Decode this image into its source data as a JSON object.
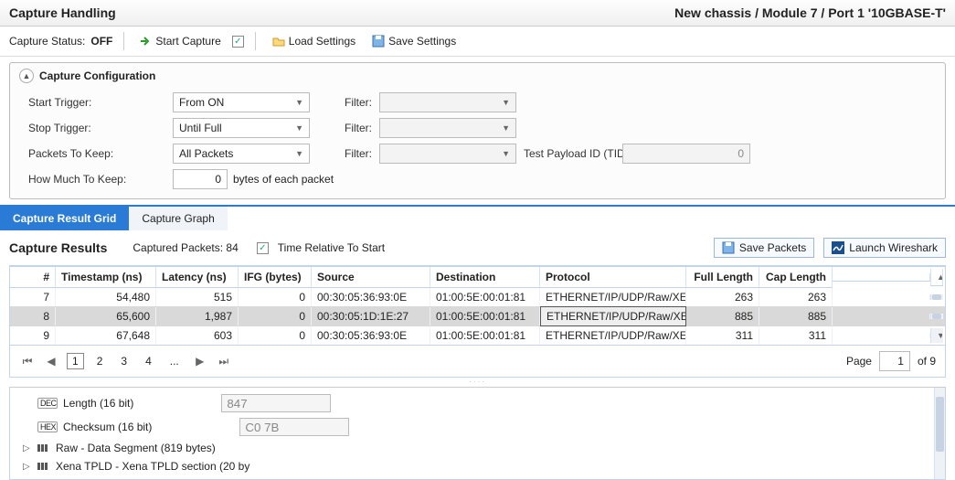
{
  "title": "Capture Handling",
  "breadcrumb": "New chassis / Module 7 / Port 1 '10GBASE-T'",
  "status": {
    "label": "Capture Status:",
    "value": "OFF"
  },
  "toolbar": {
    "start": "Start Capture",
    "load": "Load Settings",
    "save": "Save Settings"
  },
  "config": {
    "title": "Capture Configuration",
    "startTriggerLabel": "Start Trigger:",
    "startTriggerValue": "From ON",
    "stopTriggerLabel": "Stop Trigger:",
    "stopTriggerValue": "Until Full",
    "packetsLabel": "Packets To Keep:",
    "packetsValue": "All Packets",
    "howMuchLabel": "How Much To Keep:",
    "howMuchValue": "0",
    "howMuchSuffix": "bytes of each packet",
    "filterLabel": "Filter:",
    "tidLabel": "Test Payload ID (TID):",
    "tidValue": "0"
  },
  "tabs": {
    "grid": "Capture Result Grid",
    "graph": "Capture Graph"
  },
  "results": {
    "title": "Capture Results",
    "captured": "Captured Packets: 84",
    "relLabel": "Time Relative To Start",
    "savePackets": "Save Packets",
    "wireshark": "Launch Wireshark",
    "pageLabel": "Page",
    "pageNum": "1",
    "pageOf": "of 9"
  },
  "columns": {
    "idx": "#",
    "ts": "Timestamp (ns)",
    "lat": "Latency (ns)",
    "ifg": "IFG (bytes)",
    "src": "Source",
    "dst": "Destination",
    "proto": "Protocol",
    "full": "Full Length",
    "cap": "Cap Length"
  },
  "rows": [
    {
      "idx": "7",
      "ts": "54,480",
      "lat": "515",
      "ifg": "0",
      "src": "00:30:05:36:93:0E",
      "dst": "01:00:5E:00:01:81",
      "proto": "ETHERNET/IP/UDP/Raw/XE",
      "full": "263",
      "cap": "263"
    },
    {
      "idx": "8",
      "ts": "65,600",
      "lat": "1,987",
      "ifg": "0",
      "src": "00:30:05:1D:1E:27",
      "dst": "01:00:5E:00:01:81",
      "proto": "ETHERNET/IP/UDP/Raw/XE",
      "full": "885",
      "cap": "885"
    },
    {
      "idx": "9",
      "ts": "67,648",
      "lat": "603",
      "ifg": "0",
      "src": "00:30:05:36:93:0E",
      "dst": "01:00:5E:00:01:81",
      "proto": "ETHERNET/IP/UDP/Raw/XE",
      "full": "311",
      "cap": "311"
    }
  ],
  "pager": [
    "1",
    "2",
    "3",
    "4",
    "..."
  ],
  "detail": {
    "length": {
      "badge": "DEC",
      "label": "Length (16 bit)",
      "value": "847"
    },
    "checksum": {
      "badge": "HEX",
      "label": "Checksum (16 bit)",
      "value": "C0 7B"
    },
    "raw": "Raw - Data Segment (819 bytes)",
    "tpld": "Xena TPLD - Xena TPLD section (20 by"
  }
}
